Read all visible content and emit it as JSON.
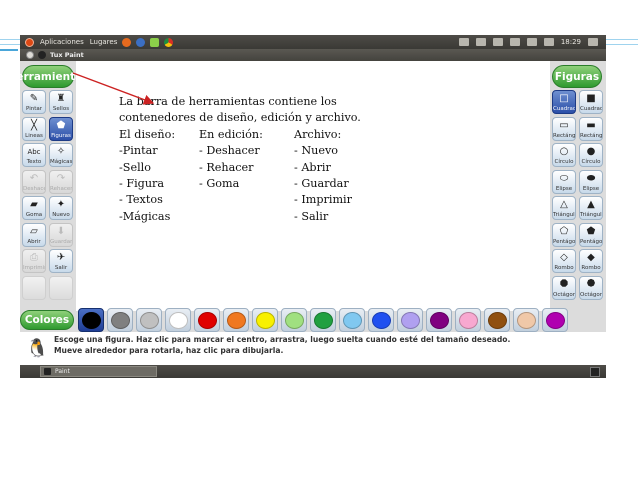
{
  "topbar": {
    "menu_apps": "Aplicaciones",
    "menu_places": "Lugares",
    "clock": "18:29"
  },
  "window": {
    "title": "Tux Paint"
  },
  "headers": {
    "tools": "Herramientas",
    "shapes": "Figuras",
    "colors": "Colores"
  },
  "tools": [
    {
      "label": "Pintar",
      "icon": "brush-icon",
      "glyph": "✎",
      "state": "normal"
    },
    {
      "label": "Sellos",
      "icon": "stamp-icon",
      "glyph": "♜",
      "state": "normal"
    },
    {
      "label": "Lineas",
      "icon": "lines-icon",
      "glyph": "╳",
      "state": "normal"
    },
    {
      "label": "Figuras",
      "icon": "shapes-icon",
      "glyph": "⬟",
      "state": "selected"
    },
    {
      "label": "Texto",
      "icon": "text-icon",
      "glyph": "Abc",
      "state": "normal"
    },
    {
      "label": "Mágicas",
      "icon": "magic-wand-icon",
      "glyph": "✧",
      "state": "normal"
    },
    {
      "label": "Deshacer",
      "icon": "undo-icon",
      "glyph": "↶",
      "state": "disabled"
    },
    {
      "label": "Rehacer",
      "icon": "redo-icon",
      "glyph": "↷",
      "state": "disabled"
    },
    {
      "label": "Goma",
      "icon": "eraser-icon",
      "glyph": "▰",
      "state": "normal"
    },
    {
      "label": "Nuevo",
      "icon": "new-file-icon",
      "glyph": "✦",
      "state": "normal"
    },
    {
      "label": "Abrir",
      "icon": "open-icon",
      "glyph": "▱",
      "state": "normal"
    },
    {
      "label": "Guardar",
      "icon": "save-icon",
      "glyph": "⬇",
      "state": "disabled"
    },
    {
      "label": "Imprimir",
      "icon": "print-icon",
      "glyph": "⎙",
      "state": "disabled"
    },
    {
      "label": "Salir",
      "icon": "exit-icon",
      "glyph": "✈",
      "state": "normal"
    }
  ],
  "shapes": [
    {
      "label": "Cuadrado",
      "icon": "square-outline-icon",
      "glyph": "□",
      "state": "selected"
    },
    {
      "label": "Cuadrado",
      "icon": "square-filled-icon",
      "glyph": "■",
      "state": "normal"
    },
    {
      "label": "Rectángulo",
      "icon": "rectangle-outline-icon",
      "glyph": "▭",
      "state": "normal"
    },
    {
      "label": "Rectángulo",
      "icon": "rectangle-filled-icon",
      "glyph": "▬",
      "state": "normal"
    },
    {
      "label": "Círculo",
      "icon": "circle-outline-icon",
      "glyph": "○",
      "state": "normal"
    },
    {
      "label": "Círculo",
      "icon": "circle-filled-icon",
      "glyph": "●",
      "state": "normal"
    },
    {
      "label": "Elipse",
      "icon": "ellipse-outline-icon",
      "glyph": "⬭",
      "state": "normal"
    },
    {
      "label": "Elipse",
      "icon": "ellipse-filled-icon",
      "glyph": "⬬",
      "state": "normal"
    },
    {
      "label": "Triángulo",
      "icon": "triangle-outline-icon",
      "glyph": "△",
      "state": "normal"
    },
    {
      "label": "Triángulo",
      "icon": "triangle-filled-icon",
      "glyph": "▲",
      "state": "normal"
    },
    {
      "label": "Pentágono",
      "icon": "pentagon-outline-icon",
      "glyph": "⬠",
      "state": "normal"
    },
    {
      "label": "Pentágono",
      "icon": "pentagon-filled-icon",
      "glyph": "⬟",
      "state": "normal"
    },
    {
      "label": "Rombo",
      "icon": "rhombus-outline-icon",
      "glyph": "◇",
      "state": "normal"
    },
    {
      "label": "Rombo",
      "icon": "rhombus-filled-icon",
      "glyph": "◆",
      "state": "normal"
    },
    {
      "label": "Octágono",
      "icon": "octagon-outline-icon",
      "glyph": "⯃",
      "state": "normal"
    },
    {
      "label": "Octágono",
      "icon": "octagon-filled-icon",
      "glyph": "⯄",
      "state": "normal"
    }
  ],
  "note": {
    "line1": "La barra de herramientas contiene los",
    "line2": "contenedores de diseño, edición y archivo.",
    "col1": [
      "El diseño:",
      "-Pintar",
      "-Sello",
      "- Figura",
      "- Textos",
      "-Mágicas"
    ],
    "col2": [
      "En edición:",
      "- Deshacer",
      "- Rehacer",
      "- Goma",
      "",
      ""
    ],
    "col3": [
      "Archivo:",
      "- Nuevo",
      "- Abrir",
      "- Guardar",
      "- Imprimir",
      "- Salir"
    ]
  },
  "palette": [
    "#000000",
    "#808080",
    "#c0c0c0",
    "#ffffff",
    "#e00000",
    "#f07820",
    "#f8f000",
    "#a0e080",
    "#20a040",
    "#80c8f0",
    "#2050f0",
    "#b0a0f0",
    "#800080",
    "#f8a8d0",
    "#905010",
    "#f0c8a8",
    "#b000b0"
  ],
  "info": {
    "line1": "Escoge una figura. Haz clic para marcar el centro, arrastra, luego suelta cuando esté del tamaño deseado.",
    "line2": "Mueve alrededor para rotarla, haz clic para dibujarla."
  },
  "taskbar": {
    "task_label": "Paint"
  },
  "colors": {
    "arrow": "#cc2222",
    "header_green": "#2f9a2f",
    "selected_blue": "#2b4fa8"
  }
}
